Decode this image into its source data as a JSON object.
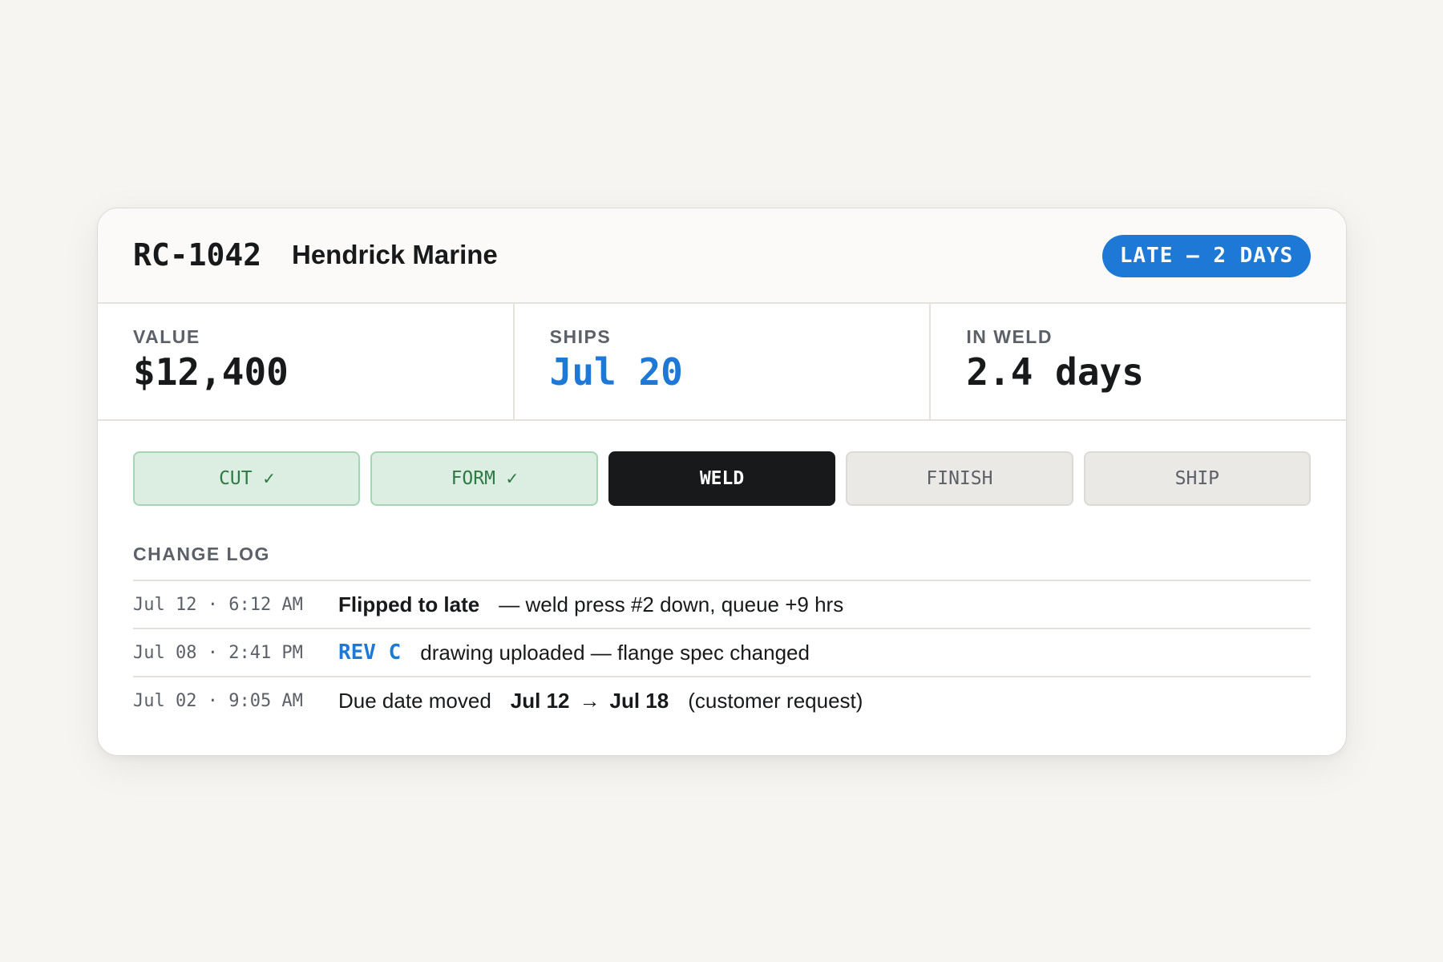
{
  "header": {
    "order_id": "RC-1042",
    "customer": "Hendrick Marine",
    "status": "LATE — 2 DAYS"
  },
  "stats": [
    {
      "label": "VALUE",
      "value": "$12,400"
    },
    {
      "label": "SHIPS",
      "value": "Jul 20"
    },
    {
      "label": "IN WELD",
      "value": "2.4 days"
    }
  ],
  "stages": [
    {
      "label": "CUT ✓",
      "state": "done"
    },
    {
      "label": "FORM ✓",
      "state": "done"
    },
    {
      "label": "WELD",
      "state": "active"
    },
    {
      "label": "FINISH",
      "state": "pending"
    },
    {
      "label": "SHIP",
      "state": "pending"
    }
  ],
  "change_log": {
    "title": "CHANGE LOG",
    "entries": [
      {
        "time": "Jul 12 · 6:12 AM",
        "event": "Flipped to late",
        "detail": "— weld press #2 down, queue +9 hrs"
      },
      {
        "time": "Jul 08 · 2:41 PM",
        "tag": "REV C",
        "detail": "drawing uploaded — flange spec changed"
      },
      {
        "time": "Jul 02 · 9:05 AM",
        "event": "Due date moved",
        "from": "Jul 12",
        "arrow": "→",
        "to": "Jul 18",
        "note": "(customer request)"
      }
    ]
  },
  "colors": {
    "accent": "#1e78d6",
    "done_bg": "#dbeee1",
    "done_text": "#2d7a45",
    "active_bg": "#18191b",
    "pending_bg": "#ebe9e5"
  }
}
